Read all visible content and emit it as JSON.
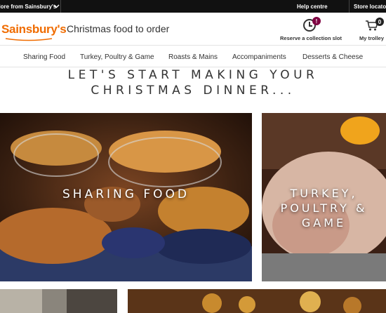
{
  "topbar": {
    "more_from": "More from Sainsbury's",
    "help": "Help centre",
    "store_locator": "Store locator"
  },
  "header": {
    "logo_text": "Sainsbury's",
    "title": "Christmas food to order",
    "reserve_label": "Reserve a collection slot",
    "reserve_alert": "!",
    "trolley_label": "My trolley",
    "trolley_count": "0"
  },
  "nav": {
    "items": [
      {
        "label": "Sharing Food"
      },
      {
        "label": "Turkey, Poultry & Game"
      },
      {
        "label": "Roasts & Mains"
      },
      {
        "label": "Accompaniments"
      },
      {
        "label": "Desserts & Cheese"
      }
    ]
  },
  "hero": {
    "line1": "LET'S START MAKING YOUR",
    "line2": "CHRISTMAS DINNER..."
  },
  "cards": [
    {
      "label": "SHARING FOOD"
    },
    {
      "label_line1": "TURKEY,",
      "label_line2": "POULTRY &",
      "label_line3": "GAME"
    }
  ],
  "colors": {
    "brand_orange": "#f06c00",
    "alert_badge": "#7f0442",
    "topbar_bg": "#111111"
  }
}
